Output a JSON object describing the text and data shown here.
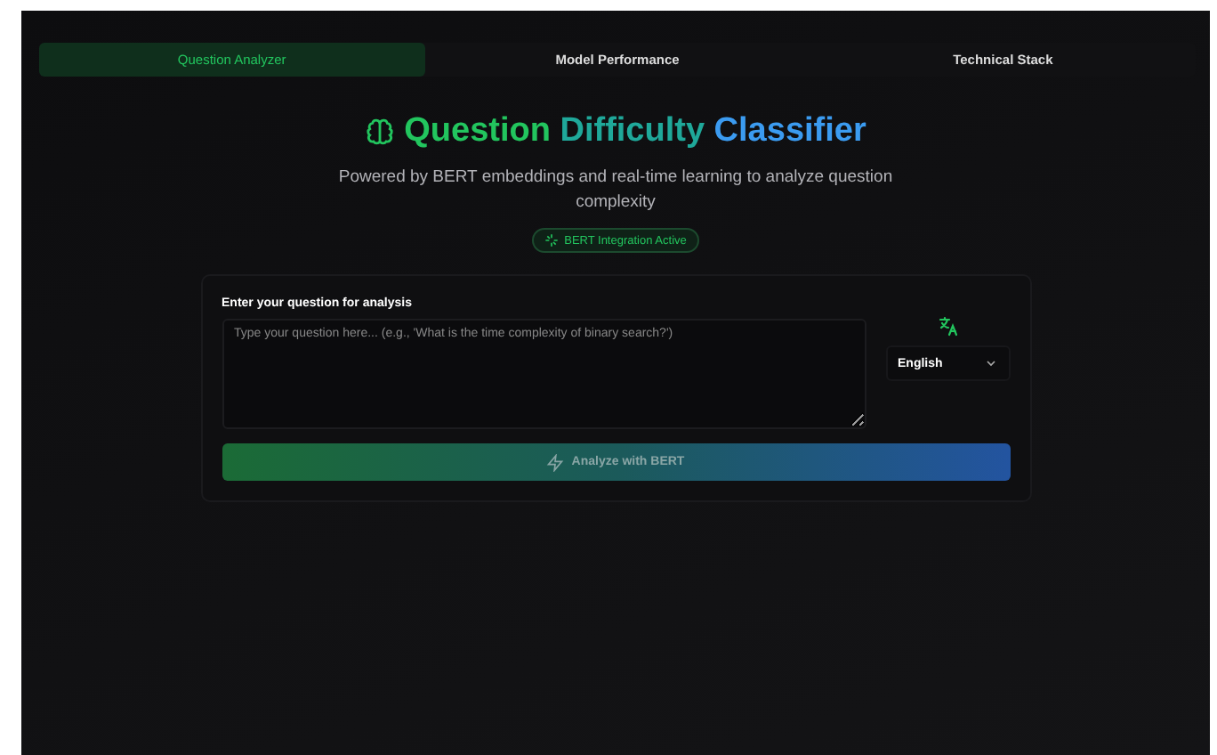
{
  "tabs": [
    {
      "label": "Question Analyzer",
      "selected": true
    },
    {
      "label": "Model Performance",
      "selected": false
    },
    {
      "label": "Technical Stack",
      "selected": false
    }
  ],
  "header": {
    "title_parts": [
      "Question",
      "Difficulty",
      "Classifier"
    ],
    "subtitle": "Powered by BERT embeddings and real-time learning to analyze question complexity",
    "badge": "BERT Integration Active"
  },
  "form": {
    "label": "Enter your question for analysis",
    "placeholder": "Type your question here... (e.g., 'What is the time complexity of binary search?')",
    "language": "English",
    "button": {
      "label": "Analyze with BERT",
      "disabled": true
    }
  }
}
